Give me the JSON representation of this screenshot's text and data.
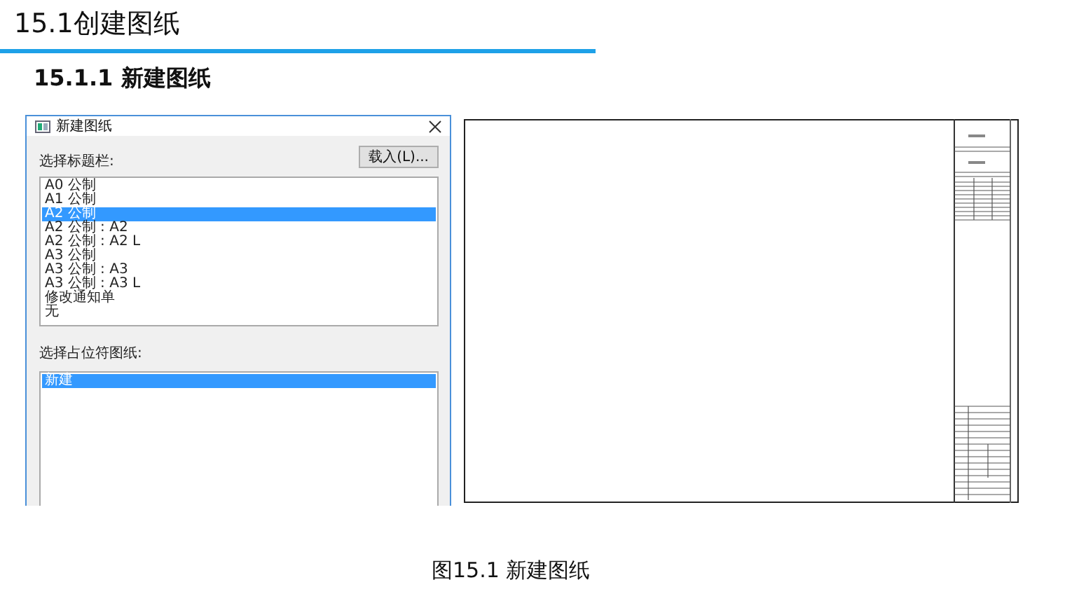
{
  "heading": "15.1创建图纸",
  "subheading": "15.1.1 新建图纸",
  "dialog": {
    "title": "新建图纸",
    "title_block_label": "选择标题栏:",
    "load_button": "载入(L)...",
    "title_blocks": [
      {
        "label": "A0 公制",
        "selected": false
      },
      {
        "label": "A1 公制",
        "selected": false
      },
      {
        "label": "A2 公制",
        "selected": true
      },
      {
        "label": "A2 公制 : A2",
        "selected": false
      },
      {
        "label": "A2 公制 : A2 L",
        "selected": false
      },
      {
        "label": "A3 公制",
        "selected": false
      },
      {
        "label": "A3 公制 : A3",
        "selected": false
      },
      {
        "label": "A3 公制 : A3 L",
        "selected": false
      },
      {
        "label": "修改通知单",
        "selected": false
      },
      {
        "label": "无",
        "selected": false
      }
    ],
    "placeholder_label": "选择占位符图纸:",
    "placeholder_sheets": [
      {
        "label": "新建",
        "selected": true
      }
    ]
  },
  "caption": "图15.1  新建图纸"
}
